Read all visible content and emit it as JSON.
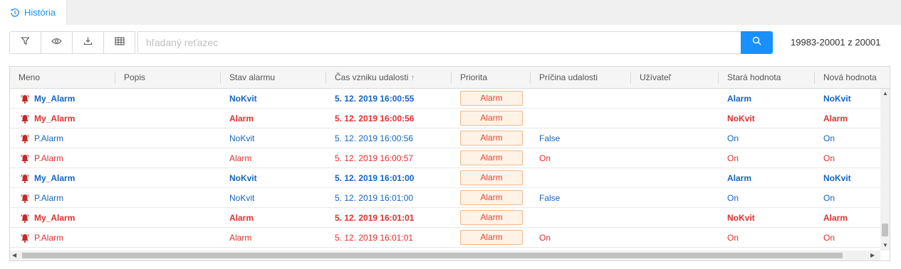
{
  "tab": {
    "label": "História",
    "icon": "history-icon"
  },
  "toolbar": {
    "buttons": [
      "filter-icon",
      "eye-icon",
      "download-icon",
      "table-icon"
    ],
    "search_placeholder": "hľadaný reťazec",
    "search_button_icon": "search-icon",
    "record_count": "19983-20001 z 20001"
  },
  "columns": [
    "Meno",
    "Popis",
    "Stav alarmu",
    "Čas vzniku udalosti",
    "Priorita",
    "Príčina udalosti",
    "Užívateľ",
    "Stará hodnota",
    "Nová hodnota"
  ],
  "sort_indicator": "↑",
  "colors": {
    "accent": "#1890ff",
    "blue_text": "#1565c0",
    "red_text": "#e03030",
    "badge_border": "#f5b88a",
    "badge_bg": "#fff3e8"
  },
  "rows": [
    {
      "name": "My_Alarm",
      "description": "",
      "state": "NoKvit",
      "time": "5. 12. 2019 16:00:55",
      "priority": "Alarm",
      "cause": "",
      "user": "",
      "old": "Alarm",
      "new": "NoKvit",
      "color": "blue",
      "bold": true
    },
    {
      "name": "My_Alarm",
      "description": "",
      "state": "Alarm",
      "time": "5. 12. 2019 16:00:56",
      "priority": "Alarm",
      "cause": "",
      "user": "",
      "old": "NoKvit",
      "new": "Alarm",
      "color": "red",
      "bold": true
    },
    {
      "name": "P.Alarm",
      "description": "",
      "state": "NoKvit",
      "time": "5. 12. 2019 16:00:56",
      "priority": "Alarm",
      "cause": "False",
      "user": "",
      "old": "On",
      "new": "On",
      "color": "blue",
      "bold": false
    },
    {
      "name": "P.Alarm",
      "description": "",
      "state": "Alarm",
      "time": "5. 12. 2019 16:00:57",
      "priority": "Alarm",
      "cause": "On",
      "user": "",
      "old": "On",
      "new": "On",
      "color": "red",
      "bold": false
    },
    {
      "name": "My_Alarm",
      "description": "",
      "state": "NoKvit",
      "time": "5. 12. 2019 16:01:00",
      "priority": "Alarm",
      "cause": "",
      "user": "",
      "old": "Alarm",
      "new": "NoKvit",
      "color": "blue",
      "bold": true
    },
    {
      "name": "P.Alarm",
      "description": "",
      "state": "NoKvit",
      "time": "5. 12. 2019 16:01:00",
      "priority": "Alarm",
      "cause": "False",
      "user": "",
      "old": "On",
      "new": "On",
      "color": "blue",
      "bold": false
    },
    {
      "name": "My_Alarm",
      "description": "",
      "state": "Alarm",
      "time": "5. 12. 2019 16:01:01",
      "priority": "Alarm",
      "cause": "",
      "user": "",
      "old": "NoKvit",
      "new": "Alarm",
      "color": "red",
      "bold": true
    },
    {
      "name": "P.Alarm",
      "description": "",
      "state": "Alarm",
      "time": "5. 12. 2019 16:01:01",
      "priority": "Alarm",
      "cause": "On",
      "user": "",
      "old": "On",
      "new": "On",
      "color": "red",
      "bold": false
    }
  ]
}
